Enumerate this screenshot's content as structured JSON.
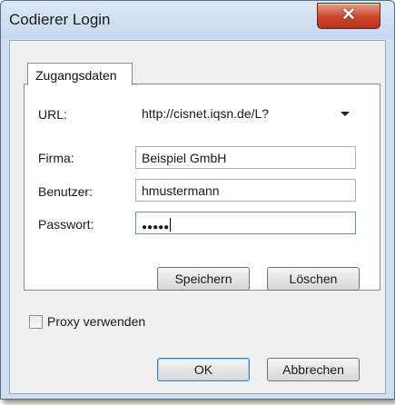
{
  "window": {
    "title": "Codierer Login",
    "close_glyph": "✕"
  },
  "tab": {
    "label": "Zugangsdaten"
  },
  "form": {
    "url_label": "URL:",
    "url_value": "http://cisnet.iqsn.de/L?",
    "firma_label": "Firma:",
    "firma_value": "Beispiel GmbH",
    "benutzer_label": "Benutzer:",
    "benutzer_value": "hmustermann",
    "passwort_label": "Passwort:",
    "passwort_value": "●●●●●"
  },
  "buttons": {
    "speichern": "Speichern",
    "loeschen": "Löschen",
    "ok": "OK",
    "abbrechen": "Abbrechen"
  },
  "proxy": {
    "label": "Proxy verwenden",
    "checked": false
  },
  "icons": {
    "close": "close-icon",
    "dropdown": "chevron-down-icon"
  }
}
